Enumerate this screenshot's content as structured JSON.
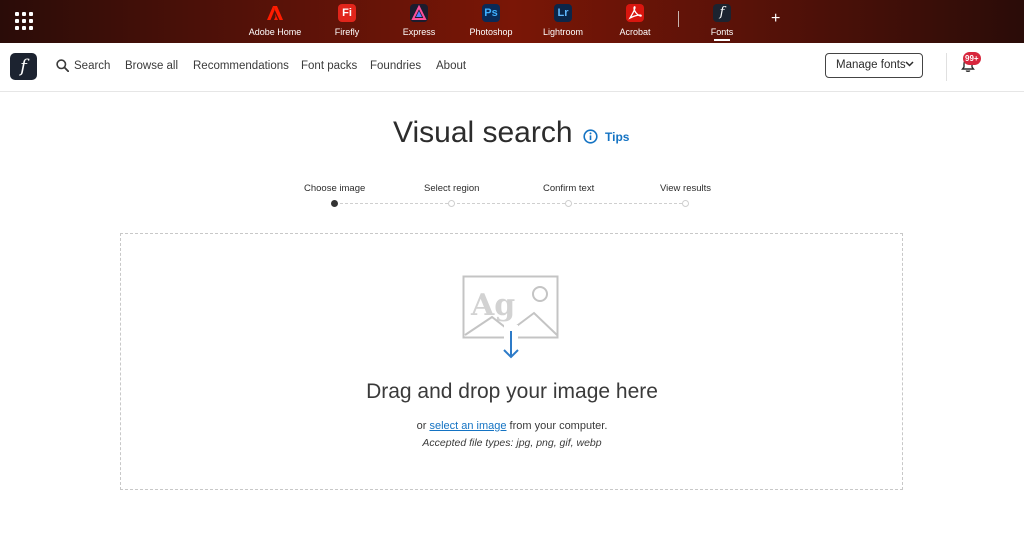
{
  "appbar": {
    "apps": [
      {
        "label": "Adobe Home",
        "glyph": "",
        "icon": "adobe-logo-icon",
        "color": "#eb1000"
      },
      {
        "label": "Firefly",
        "glyph": "Fi",
        "icon": "firefly-icon",
        "color": "#e1251b"
      },
      {
        "label": "Express",
        "glyph": "",
        "icon": "express-icon",
        "color": "#1c1c2e"
      },
      {
        "label": "Photoshop",
        "glyph": "Ps",
        "icon": "photoshop-icon",
        "color": "#0a2a57"
      },
      {
        "label": "Lightroom",
        "glyph": "Lr",
        "icon": "lightroom-icon",
        "color": "#0b2649"
      },
      {
        "label": "Acrobat",
        "glyph": "",
        "icon": "acrobat-icon",
        "color": "#d9160f"
      },
      {
        "label": "Fonts",
        "glyph": "f",
        "icon": "fonts-icon",
        "color": "#1c2330"
      }
    ],
    "plus": "+"
  },
  "nav": {
    "logo_glyph": "f",
    "search": "Search",
    "browse_all": "Browse all",
    "recommendations": "Recommendations",
    "font_packs": "Font packs",
    "foundries": "Foundries",
    "about": "About",
    "manage_fonts": "Manage fonts",
    "notification_badge": "99+"
  },
  "main": {
    "title": "Visual search",
    "tips": "Tips",
    "steps": [
      "Choose image",
      "Select region",
      "Confirm text",
      "View results"
    ],
    "current_step": 1,
    "illustration_text": "Ag",
    "drop_title": "Drag and drop your image here",
    "drop_prefix": "or ",
    "drop_link": "select an image",
    "drop_suffix": " from your computer.",
    "accepted_types": "Accepted file types: jpg, png, gif, webp"
  },
  "colors": {
    "accent_blue": "#1473c3",
    "badge_red": "#d7263d",
    "appbar_dark": "#2a0c08",
    "appbar_mid": "#7a1606"
  }
}
